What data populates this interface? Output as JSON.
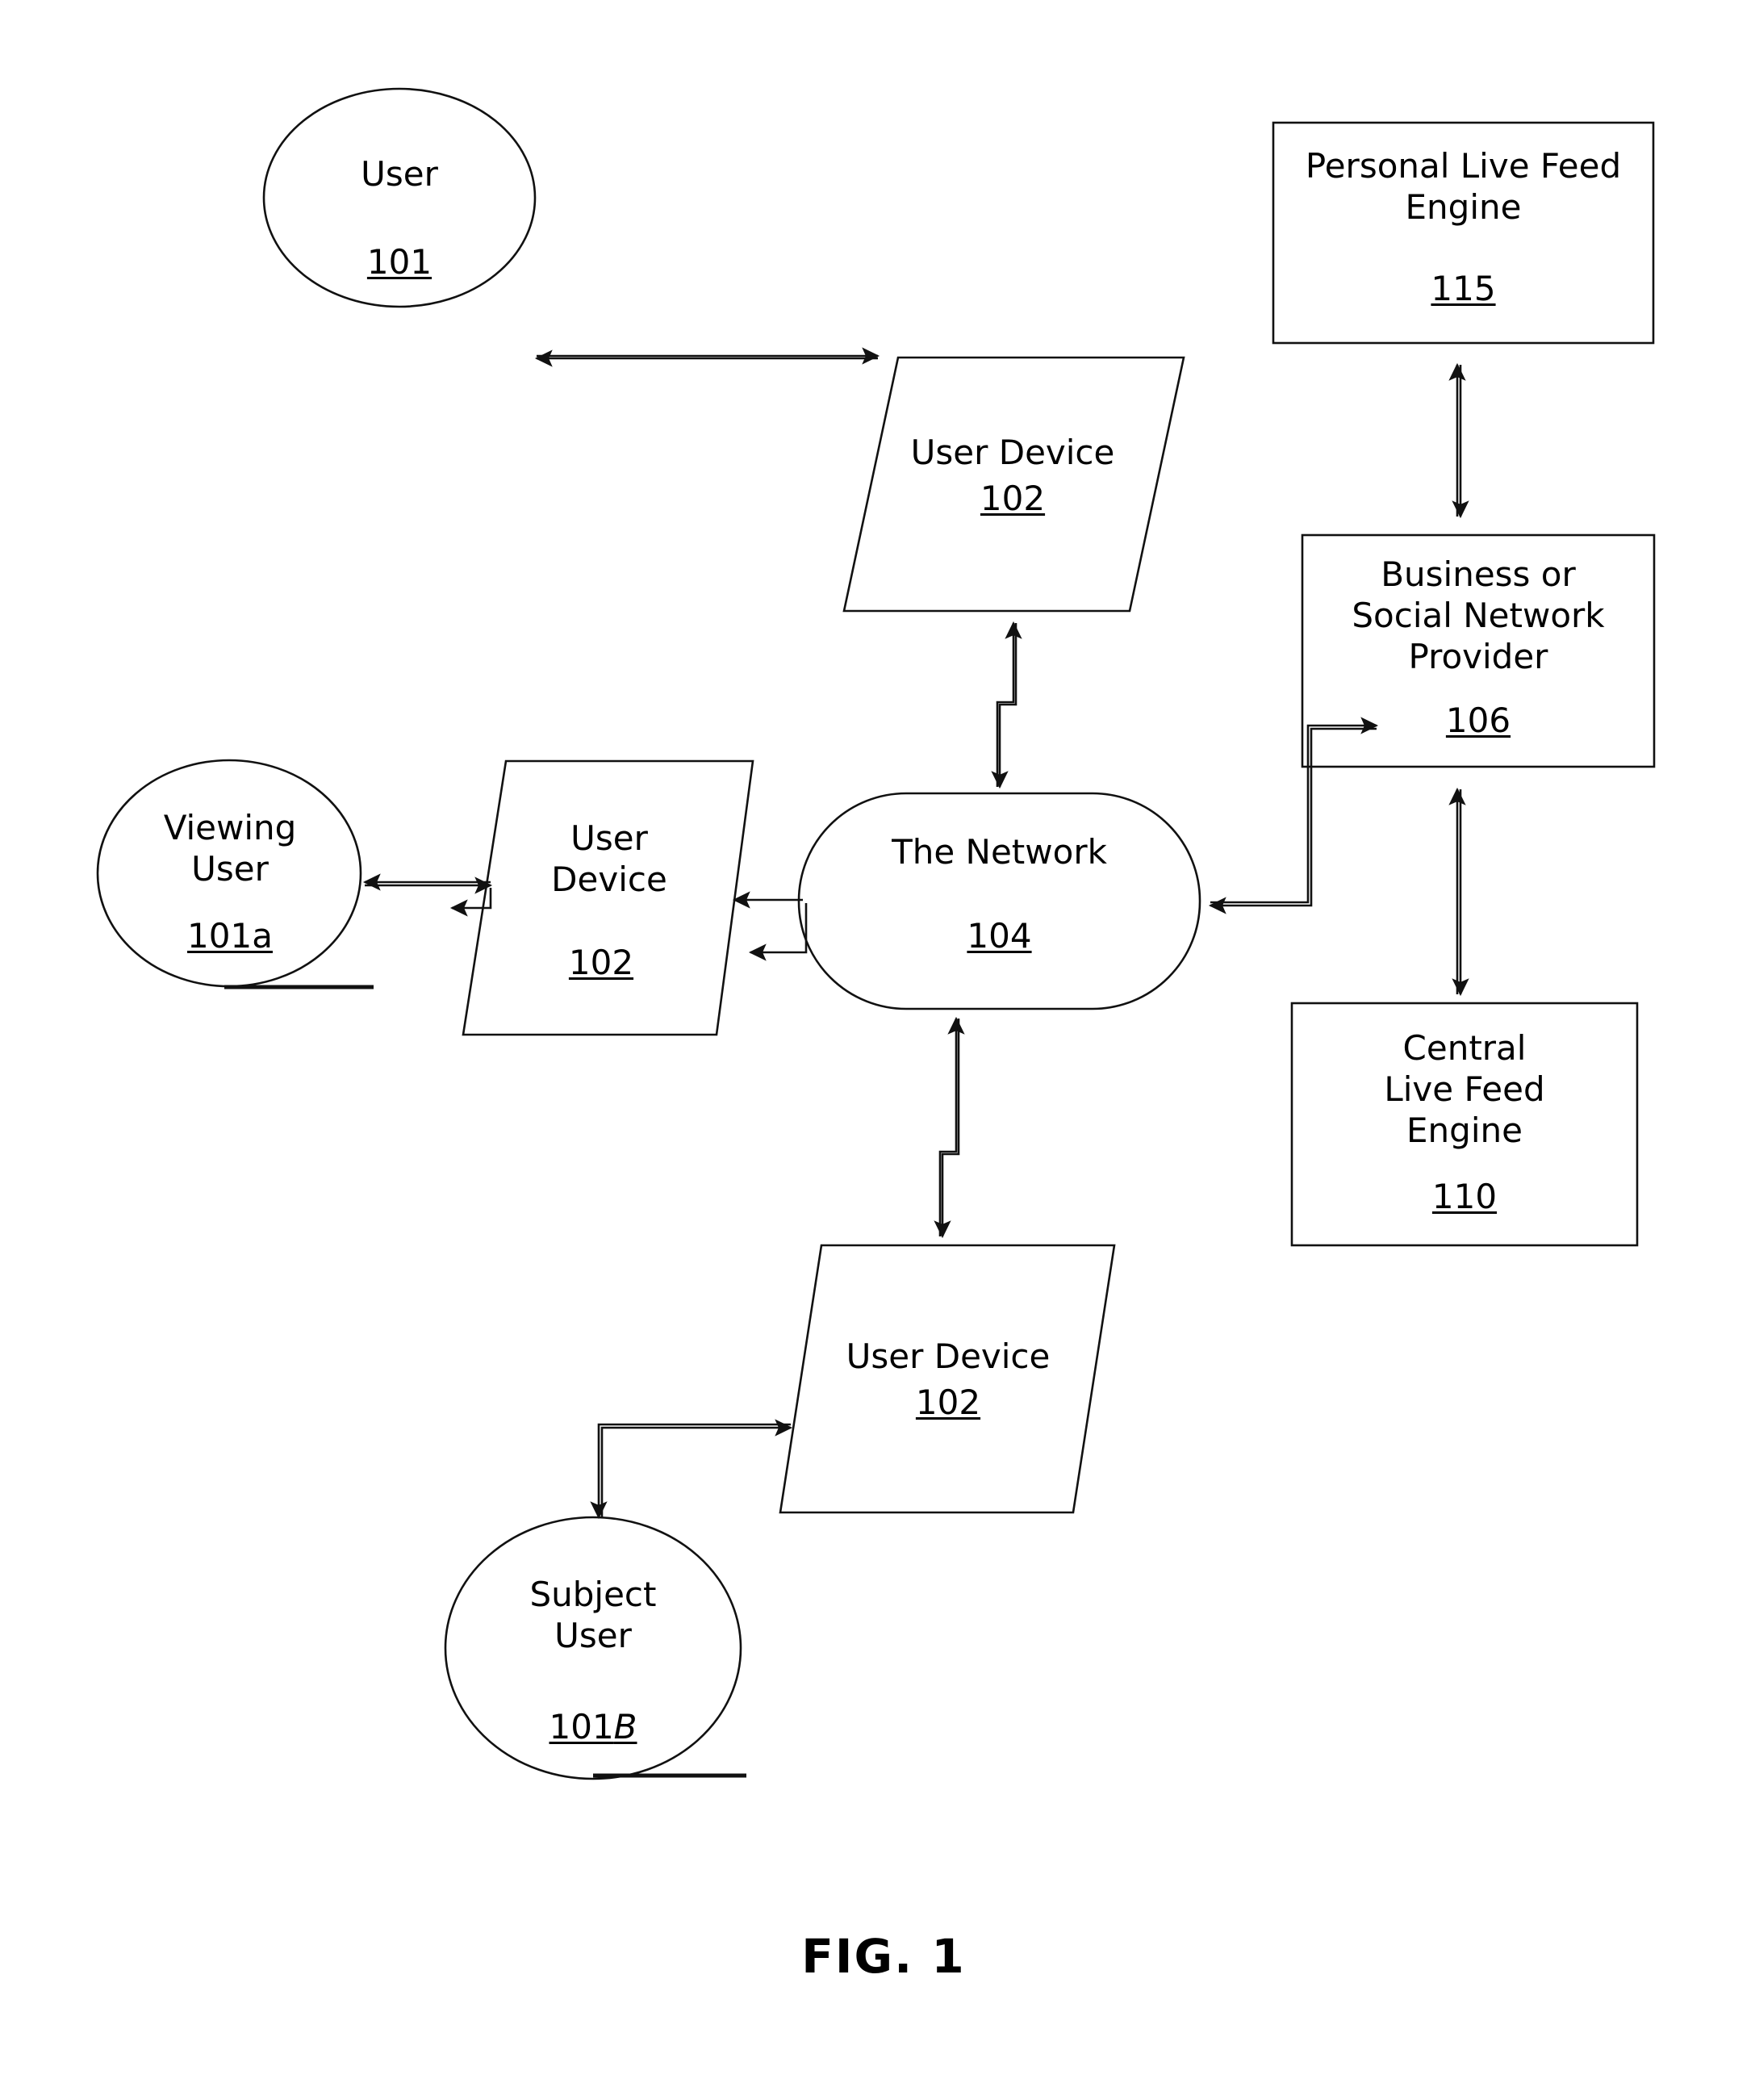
{
  "figure": {
    "caption": "FIG. 1",
    "type": "patent-system-architecture-diagram",
    "stroke_color": "#000000",
    "background_color": "#ffffff"
  },
  "nodes": {
    "user": {
      "label": "User",
      "number": "101",
      "shape": "ellipse"
    },
    "user_device_top": {
      "label": "User Device",
      "number": "102",
      "shape": "parallelogram"
    },
    "personal_live_feed_engine": {
      "label": "Personal Live Feed\nEngine",
      "number": "115",
      "shape": "rectangle"
    },
    "business_social_network_provider": {
      "label": "Business or\nSocial Network\nProvider",
      "number": "106",
      "shape": "rectangle"
    },
    "network": {
      "label": "The Network",
      "number": "104",
      "shape": "rounded-rectangle"
    },
    "viewing_user": {
      "label": "Viewing\nUser",
      "number": "101a",
      "shape": "ellipse"
    },
    "user_device_left": {
      "label": "User\nDevice",
      "number": "102",
      "shape": "parallelogram"
    },
    "central_live_feed_engine": {
      "label": "Central\nLive Feed\nEngine",
      "number": "110",
      "shape": "rectangle"
    },
    "user_device_bottom": {
      "label": "User Device",
      "number": "102",
      "shape": "parallelogram"
    },
    "subject_user": {
      "label": "Subject\nUser",
      "number_prefix": "101",
      "number_suffix": "B",
      "shape": "ellipse"
    }
  },
  "connections": [
    {
      "from": "user_device_top",
      "to": "user",
      "style": "double-arrow",
      "path": "horizontal"
    },
    {
      "from": "user_device_top",
      "to": "network",
      "style": "double-arrow",
      "path": "z-jog"
    },
    {
      "from": "personal_live_feed_engine",
      "to": "business_social_network_provider",
      "style": "double-arrow",
      "path": "vertical"
    },
    {
      "from": "business_social_network_provider",
      "to": "central_live_feed_engine",
      "style": "double-arrow",
      "path": "vertical"
    },
    {
      "from": "network",
      "to": "business_social_network_provider",
      "style": "double-arrow",
      "path": "bracket-right"
    },
    {
      "from": "network",
      "to": "user_device_left",
      "style": "double-arrow",
      "path": "horizontal-short"
    },
    {
      "from": "user_device_left",
      "to": "viewing_user",
      "style": "double-arrow",
      "path": "horizontal"
    },
    {
      "from": "network",
      "to": "user_device_bottom",
      "style": "double-arrow",
      "path": "z-jog"
    },
    {
      "from": "user_device_bottom",
      "to": "subject_user",
      "style": "double-arrow",
      "path": "bracket-left"
    }
  ]
}
